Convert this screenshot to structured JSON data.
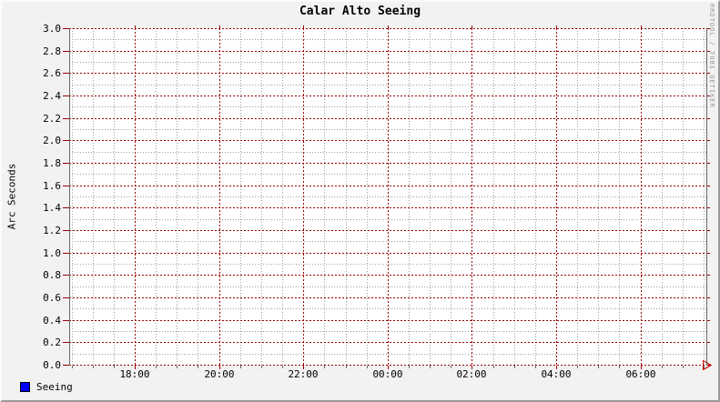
{
  "watermark": "RRDTOOL / TOBI OETIKER",
  "legend": [
    {
      "label": "Seeing",
      "color": "#0000ff"
    }
  ],
  "colors": {
    "background": "#f2f2f2",
    "canvas": "#ffffff",
    "major_grid": "#990000",
    "minor_grid": "#9f9f9f",
    "axis": "#666666",
    "arrow": "#cc0000",
    "watermark_text": "#999999"
  },
  "chart_data": {
    "type": "line",
    "title": "Calar Alto Seeing",
    "xlabel": "",
    "ylabel": "Arc Seconds",
    "ylim": [
      0.0,
      3.0
    ],
    "y_major_step": 0.2,
    "y_minor_step": 0.1,
    "y_ticks": [
      "0.0",
      "0.2",
      "0.4",
      "0.6",
      "0.8",
      "1.0",
      "1.2",
      "1.4",
      "1.6",
      "1.8",
      "2.0",
      "2.2",
      "2.4",
      "2.6",
      "2.8",
      "3.0"
    ],
    "x_ticks": [
      "18:00",
      "20:00",
      "22:00",
      "00:00",
      "02:00",
      "04:00",
      "06:00"
    ],
    "x_major_interval": "2h",
    "x_minor_interval": "30m",
    "grid": true,
    "legend_position": "bottom-left",
    "series": [
      {
        "name": "Seeing",
        "color": "#0000ff",
        "values": []
      }
    ]
  }
}
